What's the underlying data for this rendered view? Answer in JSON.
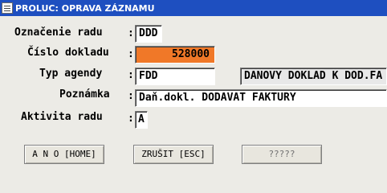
{
  "window": {
    "title": "PROLUC: OPRAVA ZÁZNAMU",
    "icon": "document-icon"
  },
  "form": {
    "oznacenie_radu": {
      "label": "Označenie radu",
      "value": "DDD"
    },
    "cislo_dokladu": {
      "label": "Číslo dokladu",
      "value": "528000",
      "highlight_color": "#f07828"
    },
    "typ_agendy": {
      "label": "Typ agendy",
      "value": "FDD",
      "description": "DANOVY DOKLAD K DOD.FA"
    },
    "poznamka": {
      "label": "Poznámka",
      "value": "Daň.dokl. DODAVAT FAKTURY"
    },
    "aktivita_radu": {
      "label": "Aktivita radu",
      "value": "A"
    },
    "colon": ":"
  },
  "buttons": {
    "ano": "A N O [HOME]",
    "zrusit": "ZRUŠIT [ESC]",
    "unknown": "?????"
  },
  "colors": {
    "titlebar": "#1e4fc0",
    "background": "#ecebe6"
  }
}
